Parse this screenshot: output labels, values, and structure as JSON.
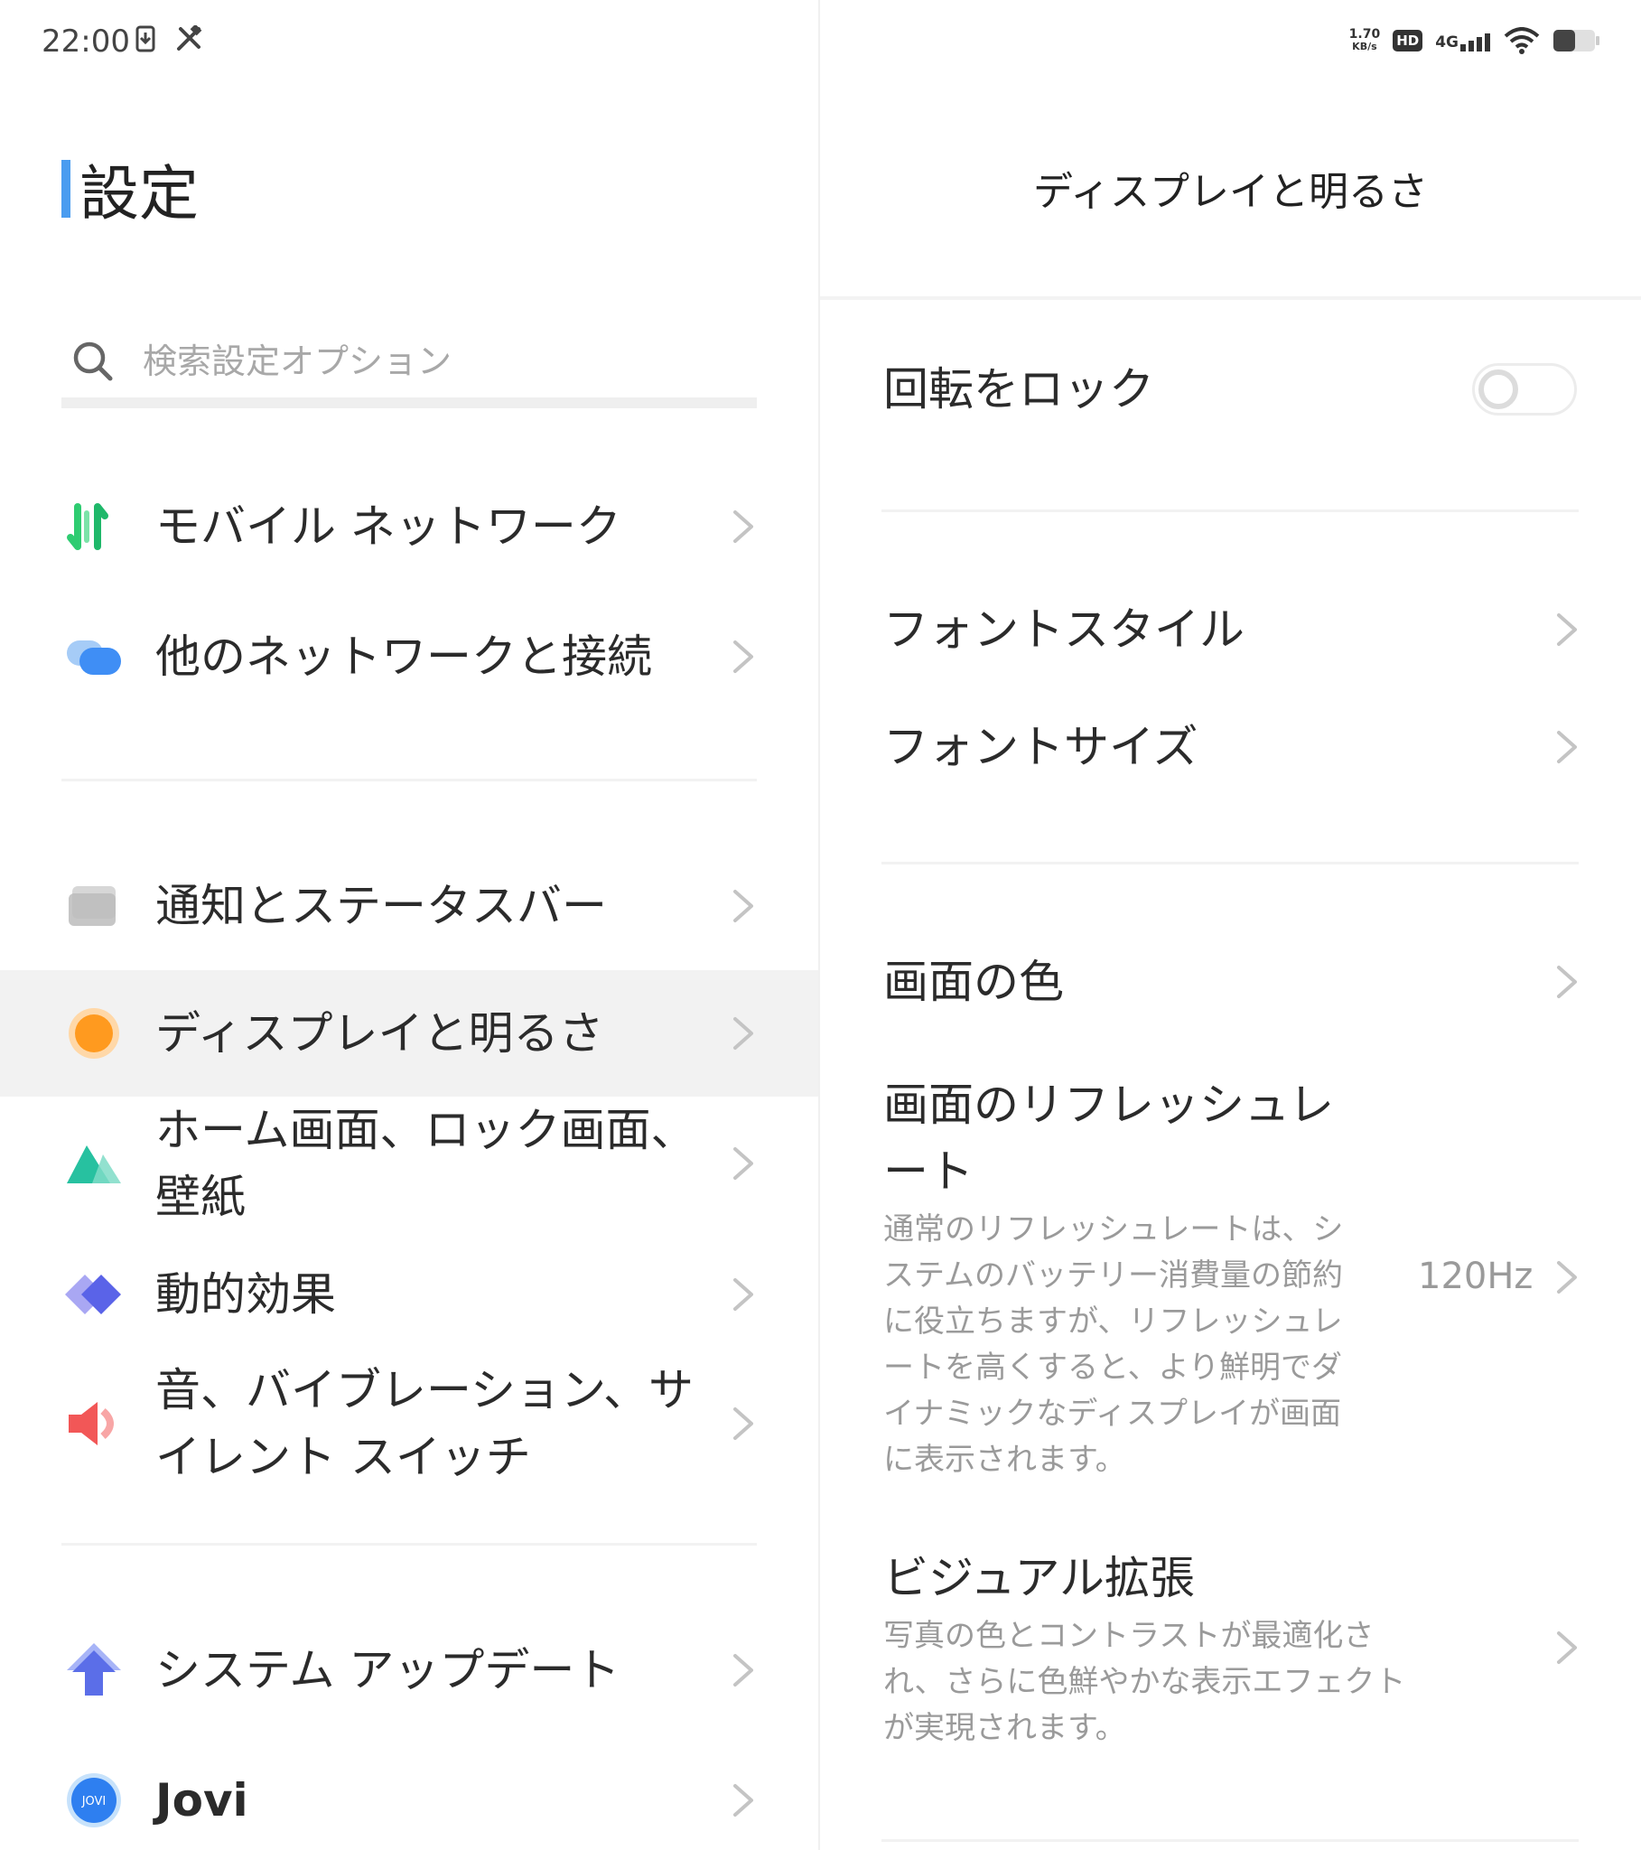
{
  "status_bar": {
    "time": "22:00",
    "speed_value": "1.70",
    "speed_unit": "KB/s",
    "hd_label": "HD",
    "network_label": "4G",
    "left_icons": [
      "download-indicator-icon",
      "tools-icon"
    ],
    "right_icons": [
      "signal-icon",
      "wifi-icon",
      "battery-icon"
    ]
  },
  "left": {
    "title": "設定",
    "search_placeholder": "検索設定オプション",
    "items": [
      {
        "label": "モバイル ネットワーク",
        "icon": "mobile-network-icon"
      },
      {
        "label": "他のネットワークと接続",
        "icon": "connections-icon"
      },
      {
        "label": "通知とステータスバー",
        "icon": "notification-icon"
      },
      {
        "label": "ディスプレイと明るさ",
        "icon": "display-icon",
        "selected": true
      },
      {
        "label": "ホーム画面、ロック画面、壁紙",
        "icon": "wallpaper-icon"
      },
      {
        "label": "動的効果",
        "icon": "dynamic-effects-icon"
      },
      {
        "label": "音、バイブレーション、サイレント スイッチ",
        "icon": "sound-icon"
      },
      {
        "label": "システム アップデート",
        "icon": "system-update-icon"
      },
      {
        "label": "Jovi",
        "icon": "jovi-icon",
        "icon_text": "JOVI"
      }
    ]
  },
  "right": {
    "title": "ディスプレイと明るさ",
    "rotation_lock": {
      "label": "回転をロック",
      "enabled": false
    },
    "font_style": {
      "label": "フォントスタイル"
    },
    "font_size": {
      "label": "フォントサイズ"
    },
    "screen_color": {
      "label": "画面の色"
    },
    "refresh_rate": {
      "label_line1": "画面のリフレッシュレ",
      "label_line2": "ート",
      "description": "通常のリフレッシュレートは、システムのバッテリー消費量の節約に役立ちますが、リフレッシュレートを高くすると、より鮮明でダイナミックなディスプレイが画面に表示されます。",
      "value": "120Hz"
    },
    "visual_enhance": {
      "label": "ビジュアル拡張",
      "description": "写真の色とコントラストが最適化され、さらに色鮮やかな表示エフェクトが実現されます。"
    }
  }
}
